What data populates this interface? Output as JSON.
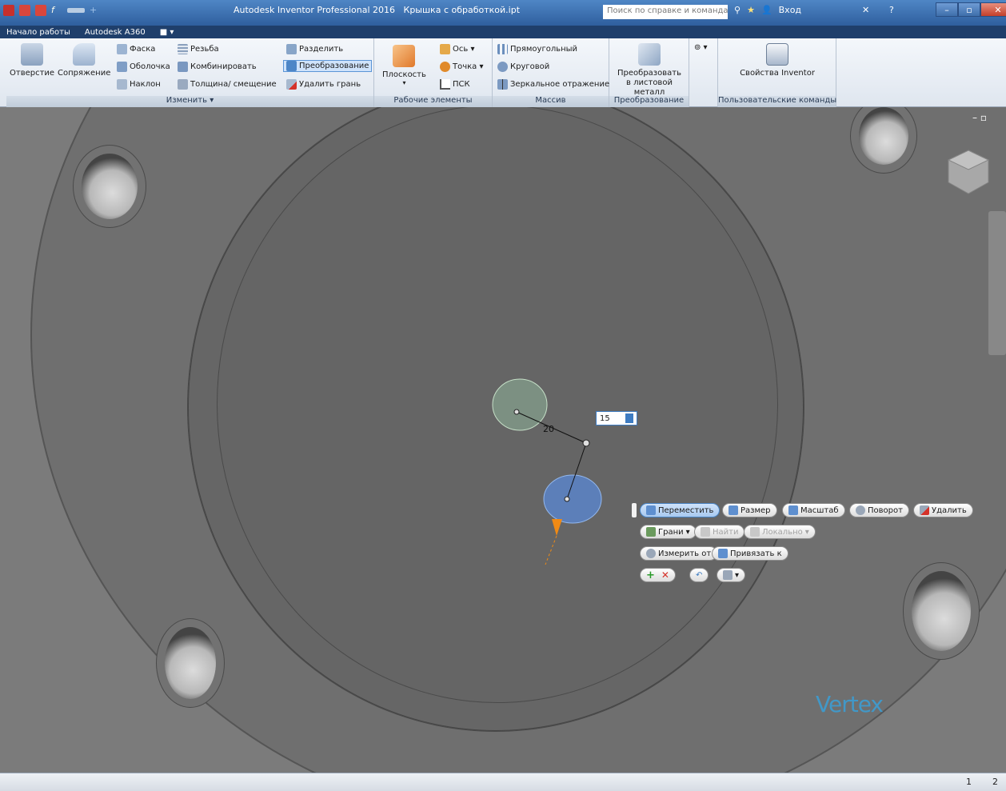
{
  "app": {
    "title": "Autodesk Inventor Professional 2016",
    "document": "Крышка с обработкой.ipt",
    "search_placeholder": "Поиск по справке и командам...",
    "login": "Вход"
  },
  "menu": {
    "tabs": [
      "Начало работы",
      "Autodesk A360"
    ]
  },
  "ribbon": {
    "modify": {
      "hole": "Отверстие",
      "fillet": "Сопряжение",
      "chamfer": "Фаска",
      "shell": "Оболочка",
      "draft": "Наклон",
      "thread": "Резьба",
      "combine": "Комбинировать",
      "thicken": "Толщина/ смещение",
      "split": "Разделить",
      "direct_edit": "Преобразование",
      "delete_face": "Удалить грань",
      "label": "Изменить ▾"
    },
    "work_features": {
      "plane": "Плоскость",
      "axis": "Ось ▾",
      "point": "Точка ▾",
      "ucs": "ПСК",
      "label": "Рабочие элементы"
    },
    "pattern": {
      "rectangular": "Прямоугольный",
      "circular": "Круговой",
      "mirror": "Зеркальное отражение",
      "label": "Массив"
    },
    "convert": {
      "to_sheet_metal": "Преобразовать в листовой металл",
      "label": "Преобразование"
    },
    "custom": {
      "iproperties": "Свойства Inventor",
      "label": "Пользовательские команды"
    }
  },
  "viewport": {
    "dimension_value": "20",
    "dimension_input": "15",
    "watermark": "Vertex"
  },
  "mini_toolbar": {
    "move": "Переместить",
    "size": "Размер",
    "scale": "Масштаб",
    "rotate": "Поворот",
    "delete": "Удалить",
    "faces": "Грани",
    "locate": "Найти",
    "local": "Локально",
    "measure_from": "Измерить от",
    "snap_to": "Привязать к"
  },
  "status": {
    "page_1": "1",
    "page_2": "2"
  },
  "colors": {
    "accent": "#3e7cc2",
    "title_bar": "#3a6aa9",
    "viewport_bg": "#7b7b7b"
  }
}
